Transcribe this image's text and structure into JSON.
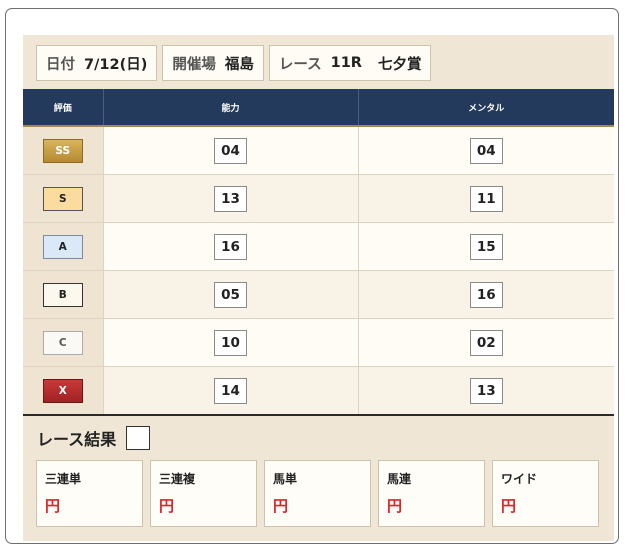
{
  "info": {
    "date_label": "日付",
    "date_value": "7/12(日)",
    "venue_label": "開催場",
    "venue_value": "福島",
    "race_label": "レース",
    "race_number": "11R",
    "race_name": "七夕賞"
  },
  "table": {
    "headers": [
      "評価",
      "能力",
      "メンタル"
    ],
    "rows": [
      {
        "rank": "SS",
        "ability": "04",
        "mental": "04"
      },
      {
        "rank": "S",
        "ability": "13",
        "mental": "11"
      },
      {
        "rank": "A",
        "ability": "16",
        "mental": "15"
      },
      {
        "rank": "B",
        "ability": "05",
        "mental": "16"
      },
      {
        "rank": "C",
        "ability": "10",
        "mental": "02"
      },
      {
        "rank": "X",
        "ability": "14",
        "mental": "13"
      }
    ]
  },
  "result": {
    "title": "レース結果",
    "payouts": [
      {
        "label": "三連単",
        "value": "円"
      },
      {
        "label": "三連複",
        "value": "円"
      },
      {
        "label": "馬単",
        "value": "円"
      },
      {
        "label": "馬連",
        "value": "円"
      },
      {
        "label": "ワイド",
        "value": "円"
      }
    ]
  },
  "colors": {
    "header_bg": "#243a5c",
    "panel_bg": "#f0e6d6",
    "ss_gold": "#c9a04a",
    "s_yellow": "#f9dc9e",
    "a_blue": "#dbe8f7",
    "x_red": "#b52c2e",
    "payout_red": "#d9262a"
  }
}
